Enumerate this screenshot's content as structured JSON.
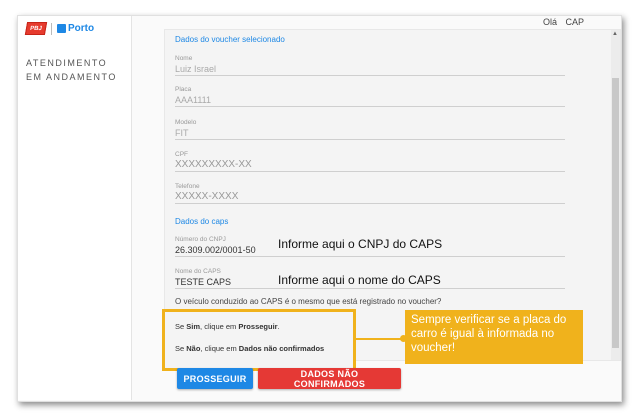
{
  "header": {
    "greeting": "Olá",
    "user": "CAP"
  },
  "sidebar": {
    "status_text": "ATENDIMENTO EM ANDAMENTO",
    "brand_flag": "PBJ",
    "brand_porto": "Porto"
  },
  "voucher": {
    "section_title": "Dados do voucher selecionado",
    "fields": [
      {
        "label": "Nome",
        "value": "Luiz Israel"
      },
      {
        "label": "Placa",
        "value": "AAA1111"
      },
      {
        "label": "Modelo",
        "value": "FIT"
      },
      {
        "label": "CPF",
        "value": "XXXXXXXXX-XX"
      },
      {
        "label": "Telefone",
        "value": "XXXXX-XXXX"
      }
    ]
  },
  "caps": {
    "section_title": "Dados do caps",
    "fields": [
      {
        "label": "Número do CNPJ",
        "value": "26.309.002/0001-50"
      },
      {
        "label": "Nome do CAPS",
        "value": "TESTE CAPS"
      }
    ],
    "question": "O veículo conduzido ao CAPS é o mesmo que está registrado no voucher?"
  },
  "hints": {
    "cnpj": "Informe aqui o CNPJ do CAPS",
    "nome": "Informe aqui o nome do CAPS"
  },
  "instructions": {
    "line1_pre": "Se ",
    "line1_strong": "Sim",
    "line1_mid": ", clique em ",
    "line1_action": "Prosseguir",
    "line1_post": ".",
    "line2_pre": "Se ",
    "line2_strong": "Não",
    "line2_mid": ", clique em ",
    "line2_action": "Dados não confirmados"
  },
  "note": "Sempre verificar se a placa do carro é igual à informada no voucher!",
  "buttons": {
    "proceed": "PROSSEGUIR",
    "not_confirmed": "DADOS NÃO CONFIRMADOS"
  },
  "colors": {
    "accent": "#1e88e5",
    "danger": "#e53935",
    "highlight": "#f0b21c"
  }
}
